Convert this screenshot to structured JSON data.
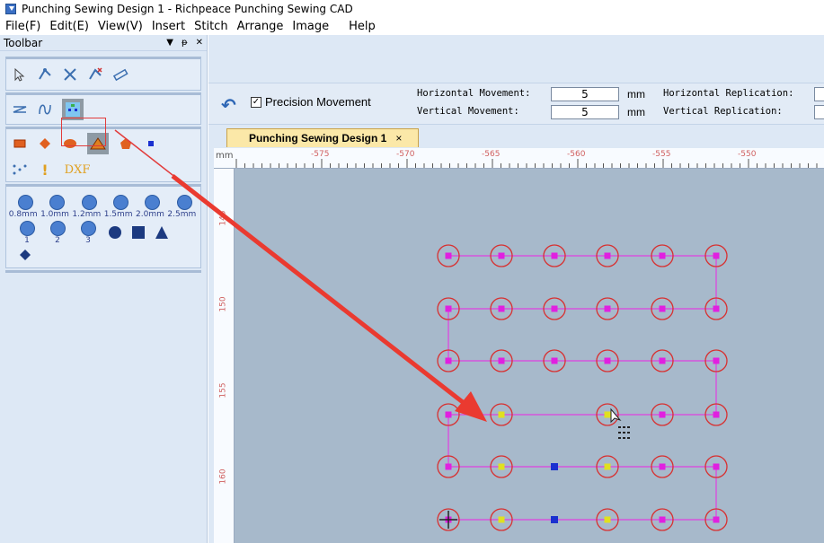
{
  "window": {
    "title": "Punching Sewing Design 1 - Richpeace Punching Sewing CAD"
  },
  "menu": [
    "File(F)",
    "Edit(E)",
    "View(V)",
    "Insert",
    "Stitch",
    "Arrange",
    "Image",
    "Help"
  ],
  "toolbar_panel": {
    "title": "Toolbar",
    "controls": {
      "dropdown": "▼",
      "pin": "ᵽ",
      "close": "✕"
    },
    "dxf_label": "DXF",
    "circle_sizes": [
      "0.8mm",
      "1.0mm",
      "1.2mm",
      "1.5mm",
      "2.0mm",
      "2.5mm"
    ],
    "numbered_circles": [
      "1",
      "2",
      "3"
    ]
  },
  "options": {
    "precision_label": "Precision Movement",
    "precision_checked": true,
    "h_move_label": "Horizontal Movement:",
    "v_move_label": "Vertical  Movement:",
    "h_move_value": "5",
    "v_move_value": "5",
    "unit": "mm",
    "h_rep_label": "Horizontal Replication:",
    "v_rep_label": "Vertical  Replication:"
  },
  "doc_tab": {
    "label": "Punching Sewing Design 1",
    "close": "×"
  },
  "ruler": {
    "unit": "mm",
    "h_labels": [
      "-575",
      "-570",
      "-565",
      "-560",
      "-555",
      "-550"
    ],
    "v_labels": [
      "145",
      "150",
      "155",
      "160"
    ]
  },
  "colors": {
    "accent": "#e23c3c",
    "stitch_line": "#e040e0",
    "marker_magenta": "#e020e0",
    "marker_yellow": "#e0e020",
    "marker_blue": "#1a30d0",
    "canvas": "#a7b9cb"
  }
}
